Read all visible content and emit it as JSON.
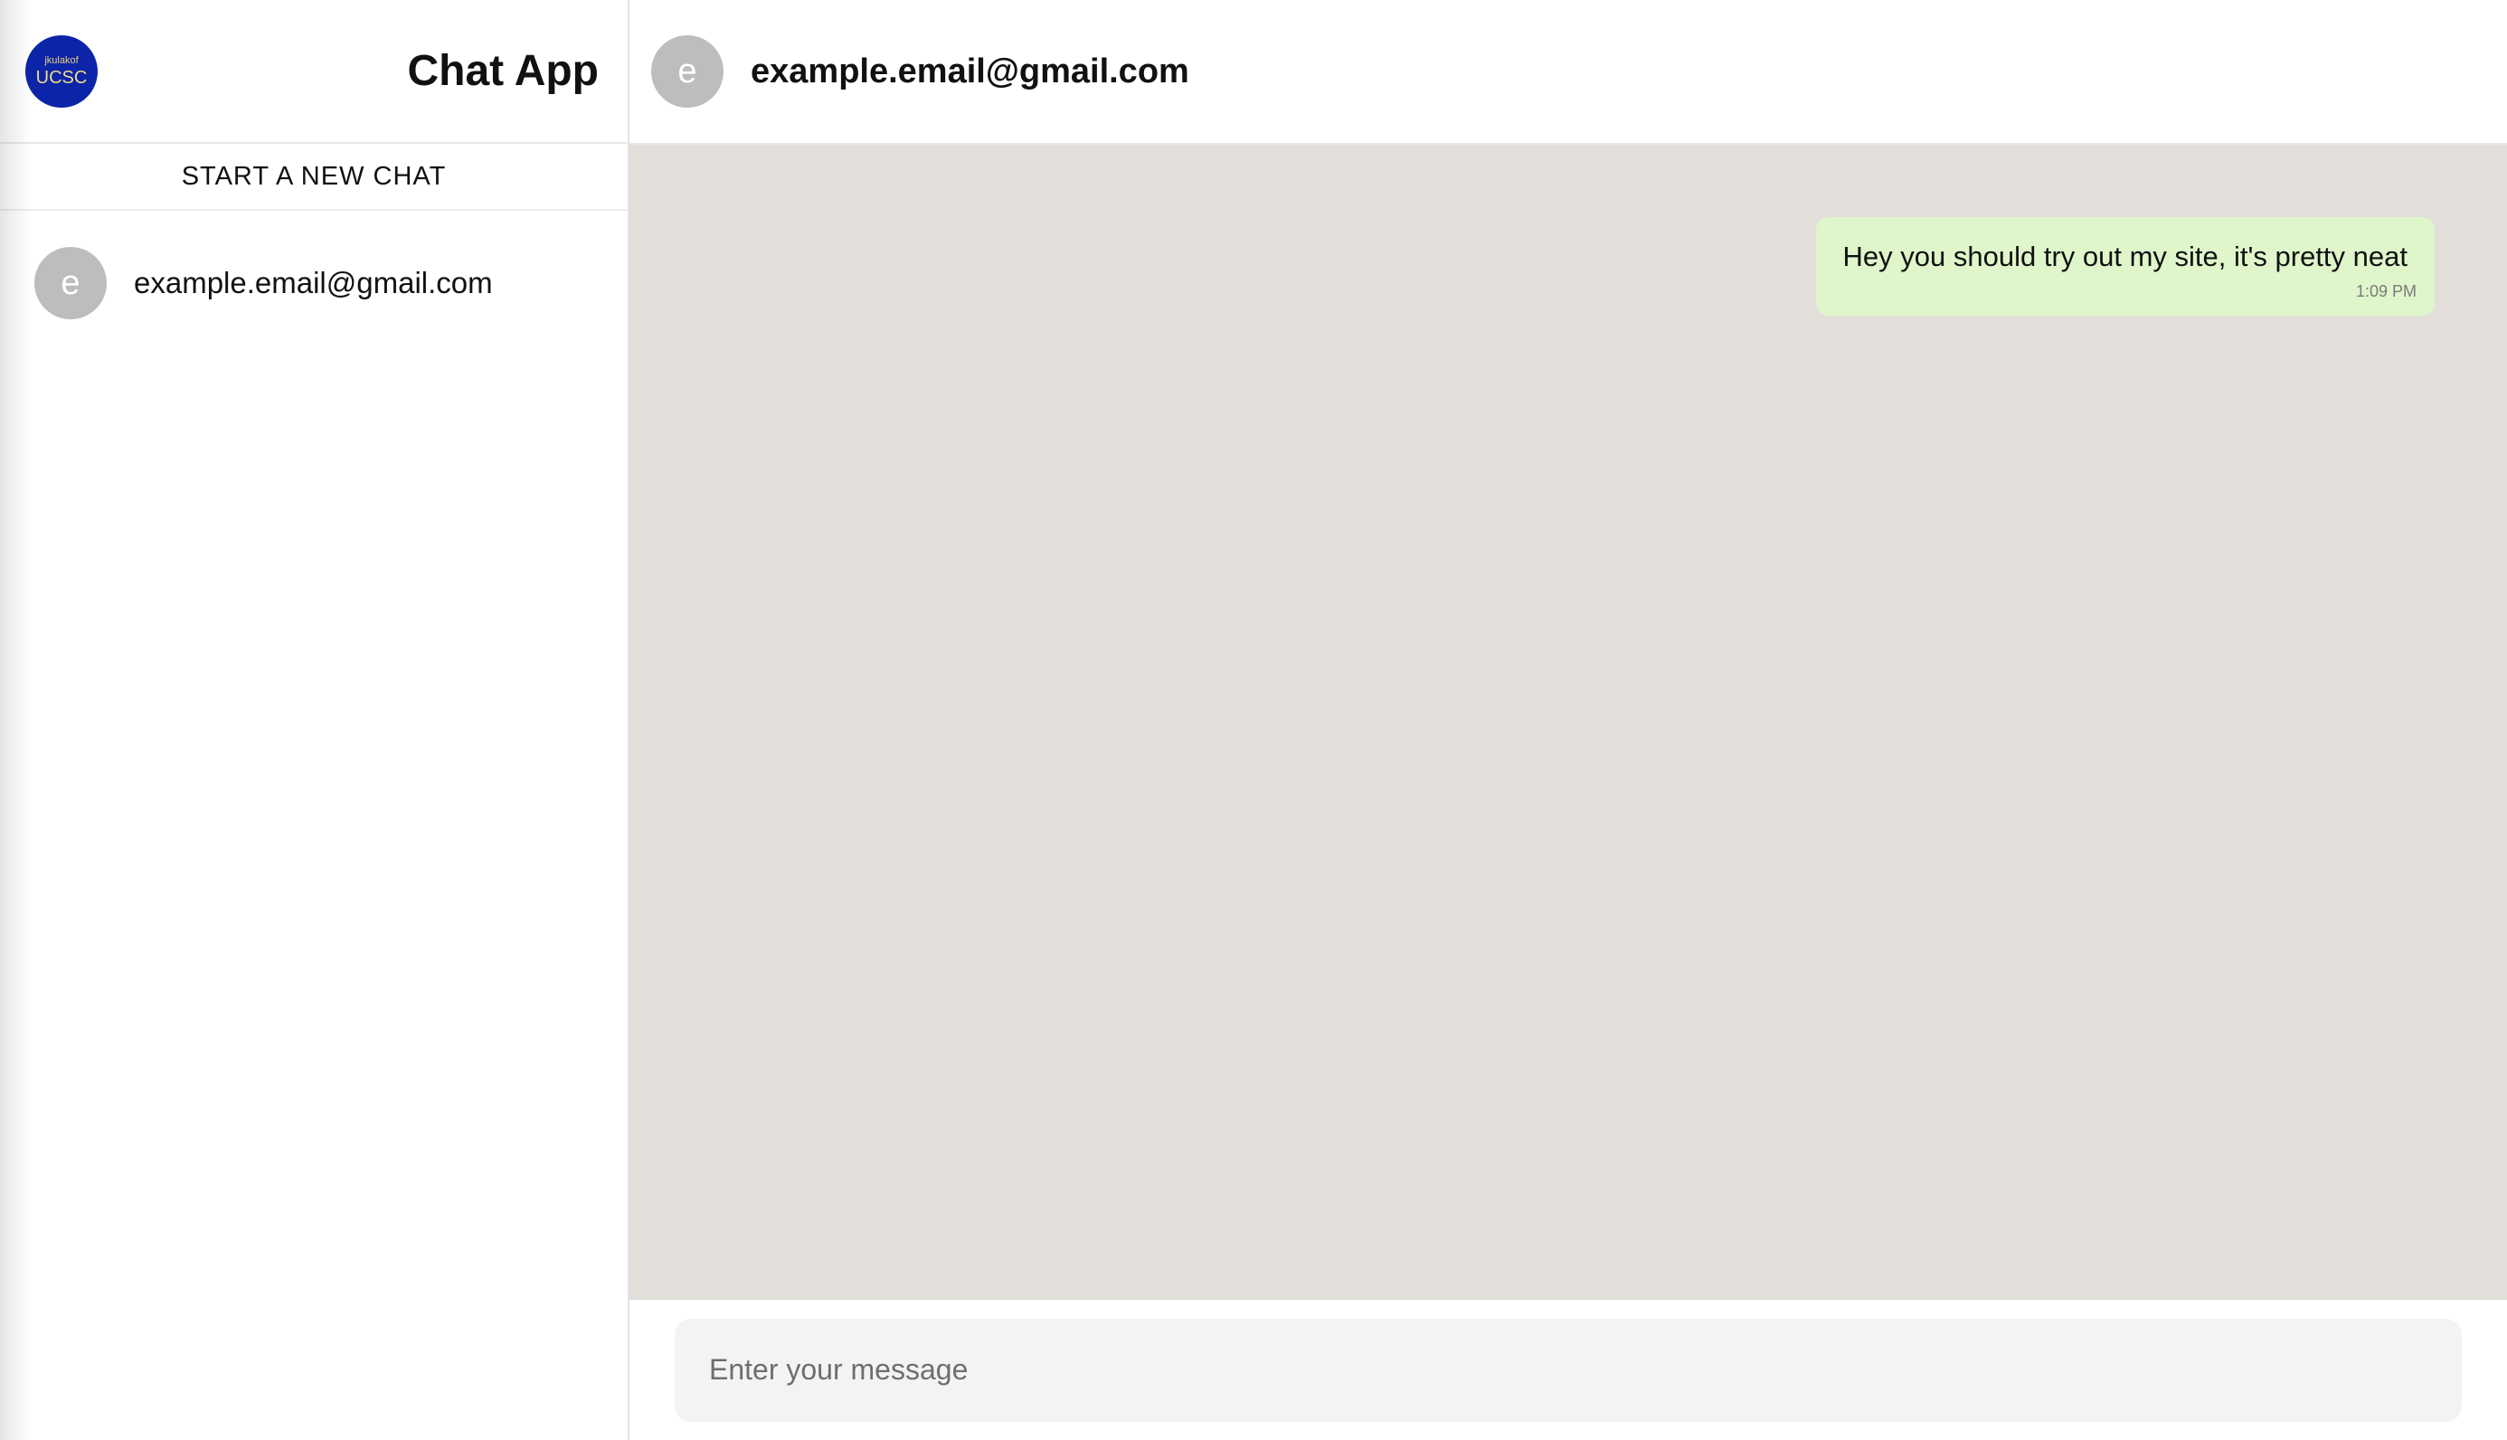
{
  "sidebar": {
    "logo": {
      "top_text": "jkulakof",
      "main_text": "UCSC"
    },
    "title": "Chat App",
    "new_chat_label": "START A NEW CHAT",
    "chats": [
      {
        "avatar_letter": "e",
        "label": "example.email@gmail.com"
      }
    ]
  },
  "header": {
    "avatar_letter": "e",
    "contact": "example.email@gmail.com"
  },
  "messages": [
    {
      "text": "Hey you should try out my site, it's pretty neat",
      "time": "1:09 PM"
    }
  ],
  "composer": {
    "placeholder": "Enter your message"
  },
  "colors": {
    "logo_bg": "#0c24a8",
    "avatar_bg": "#bdbdbd",
    "chat_bg": "#e2dfda",
    "outgoing_bubble": "#dff6cb"
  },
  "icons": {
    "logo": "ucsc-logo-icon",
    "avatar": "avatar-letter-icon"
  }
}
